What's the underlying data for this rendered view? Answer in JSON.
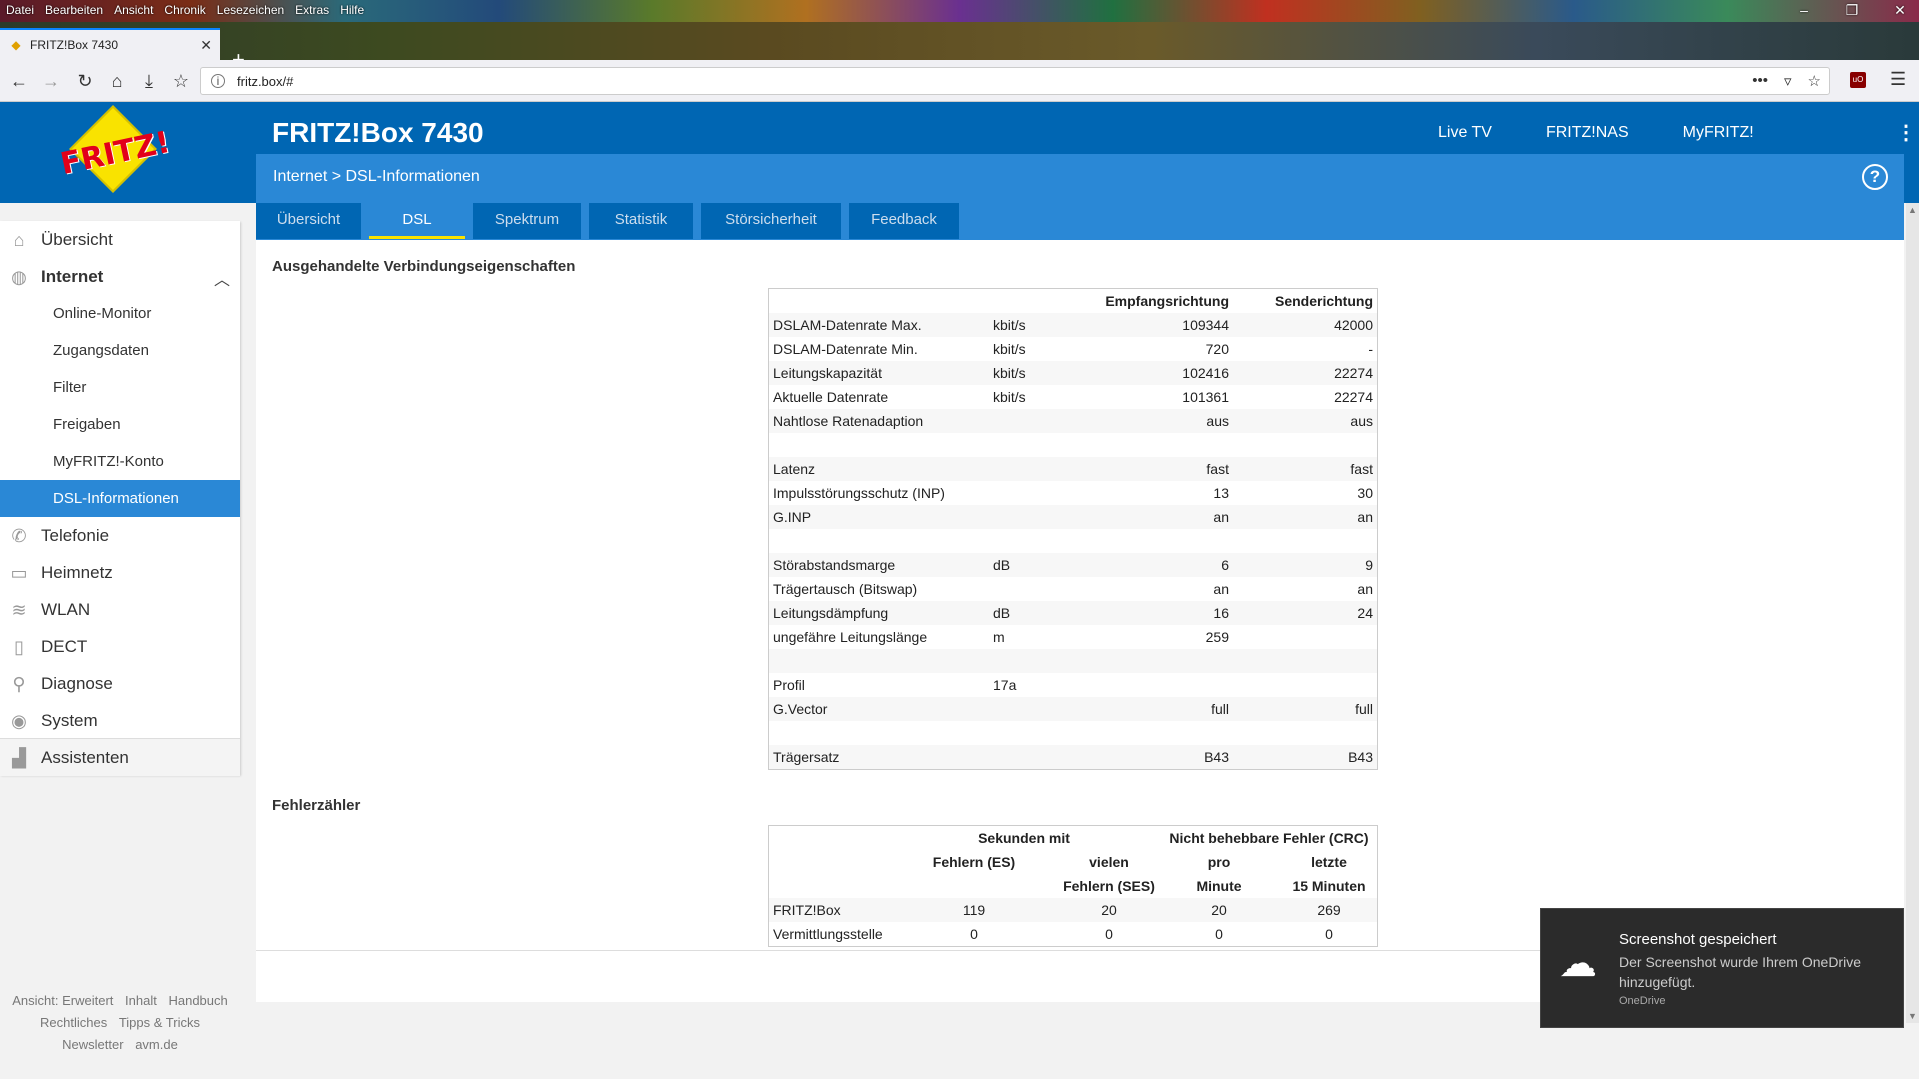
{
  "browser": {
    "menu": [
      "Datei",
      "Bearbeiten",
      "Ansicht",
      "Chronik",
      "Lesezeichen",
      "Extras",
      "Hilfe"
    ],
    "tab_title": "FRITZ!Box 7430",
    "url": "fritz.box/#"
  },
  "header": {
    "product": "FRITZ!Box 7430",
    "logo_text": "FRITZ!",
    "nav": [
      "Live TV",
      "FRITZ!NAS",
      "MyFRITZ!"
    ],
    "breadcrumb": "Internet > DSL-Informationen",
    "help": "?"
  },
  "tabs": [
    {
      "label": "Übersicht",
      "active": false
    },
    {
      "label": "DSL",
      "active": true
    },
    {
      "label": "Spektrum",
      "active": false
    },
    {
      "label": "Statistik",
      "active": false
    },
    {
      "label": "Störsicherheit",
      "active": false
    },
    {
      "label": "Feedback",
      "active": false
    }
  ],
  "sidebar": {
    "items": [
      {
        "label": "Übersicht",
        "icon": "home-icon"
      },
      {
        "label": "Internet",
        "icon": "globe-icon"
      },
      {
        "label": "Telefonie",
        "icon": "phone-icon"
      },
      {
        "label": "Heimnetz",
        "icon": "network-icon"
      },
      {
        "label": "WLAN",
        "icon": "wifi-icon"
      },
      {
        "label": "DECT",
        "icon": "dect-icon"
      },
      {
        "label": "Diagnose",
        "icon": "diagnose-icon"
      },
      {
        "label": "System",
        "icon": "system-icon"
      },
      {
        "label": "Assistenten",
        "icon": "wizard-icon"
      }
    ],
    "internet_sub": [
      "Online-Monitor",
      "Zugangsdaten",
      "Filter",
      "Freigaben",
      "MyFRITZ!-Konto",
      "DSL-Informationen"
    ],
    "active_sub": "DSL-Informationen"
  },
  "footer": {
    "row1": [
      "Ansicht: Erweitert",
      "Inhalt",
      "Handbuch"
    ],
    "row2": [
      "Rechtliches",
      "Tipps & Tricks"
    ],
    "row3": [
      "Newsletter",
      "avm.de"
    ]
  },
  "section1": {
    "title": "Ausgehandelte Verbindungseigenschaften",
    "col_rx": "Empfangsrichtung",
    "col_tx": "Senderichtung",
    "rows": [
      {
        "name": "DSLAM-Datenrate Max.",
        "unit": "kbit/s",
        "rx": "109344",
        "tx": "42000"
      },
      {
        "name": "DSLAM-Datenrate Min.",
        "unit": "kbit/s",
        "rx": "720",
        "tx": "-"
      },
      {
        "name": "Leitungskapazität",
        "unit": "kbit/s",
        "rx": "102416",
        "tx": "22274"
      },
      {
        "name": "Aktuelle Datenrate",
        "unit": "kbit/s",
        "rx": "101361",
        "tx": "22274"
      },
      {
        "name": "Nahtlose Ratenadaption",
        "unit": "",
        "rx": "aus",
        "tx": "aus"
      },
      {
        "name": "",
        "unit": "",
        "rx": "",
        "tx": ""
      },
      {
        "name": "Latenz",
        "unit": "",
        "rx": "fast",
        "tx": "fast"
      },
      {
        "name": "Impulsstörungsschutz (INP)",
        "unit": "",
        "rx": "13",
        "tx": "30"
      },
      {
        "name": "G.INP",
        "unit": "",
        "rx": "an",
        "tx": "an"
      },
      {
        "name": "",
        "unit": "",
        "rx": "",
        "tx": ""
      },
      {
        "name": "Störabstandsmarge",
        "unit": "dB",
        "rx": "6",
        "tx": "9"
      },
      {
        "name": "Trägertausch (Bitswap)",
        "unit": "",
        "rx": "an",
        "tx": "an"
      },
      {
        "name": "Leitungsdämpfung",
        "unit": "dB",
        "rx": "16",
        "tx": "24"
      },
      {
        "name": "ungefähre Leitungslänge",
        "unit": "m",
        "rx": "259",
        "tx": ""
      },
      {
        "name": "",
        "unit": "",
        "rx": "",
        "tx": ""
      },
      {
        "name": "Profil",
        "unit": "17a",
        "rx": "",
        "tx": ""
      },
      {
        "name": "G.Vector",
        "unit": "",
        "rx": "full",
        "tx": "full"
      },
      {
        "name": "",
        "unit": "",
        "rx": "",
        "tx": ""
      },
      {
        "name": "Trägersatz",
        "unit": "",
        "rx": "B43",
        "tx": "B43"
      }
    ]
  },
  "section2": {
    "title": "Fehlerzähler",
    "group1": "Sekunden mit",
    "group2": "Nicht behebbare Fehler (CRC)",
    "h1": "Fehlern (ES)",
    "h2a": "vielen",
    "h2b": "Fehlern (SES)",
    "h3a": "pro",
    "h3b": "Minute",
    "h4a": "letzte",
    "h4b": "15 Minuten",
    "rows": [
      {
        "name": "FRITZ!Box",
        "es": "119",
        "ses": "20",
        "crc_min": "20",
        "crc_15": "269"
      },
      {
        "name": "Vermittlungsstelle",
        "es": "0",
        "ses": "0",
        "crc_min": "0",
        "crc_15": "0"
      }
    ]
  },
  "toast": {
    "title": "Screenshot gespeichert",
    "body": "Der Screenshot wurde Ihrem OneDrive hinzugefügt.",
    "source": "OneDrive"
  }
}
